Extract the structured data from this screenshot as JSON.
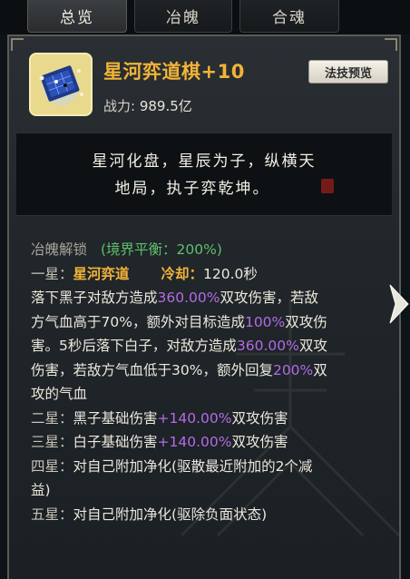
{
  "tabs": [
    {
      "label": "总览",
      "active": true
    },
    {
      "label": "冶魄",
      "active": false
    },
    {
      "label": "合魂",
      "active": false
    }
  ],
  "item": {
    "name": "星河弈道棋+10",
    "power_label": "战力:",
    "power_value": "989.5亿",
    "preview_button": "法技预览",
    "icon": "star-river-chessboard-icon"
  },
  "description": {
    "line1": "星河化盘，星辰为子，纵横天",
    "line2": "地局，执子弈乾坤。"
  },
  "unlock": {
    "title": "冶魄解锁",
    "status": "(境界平衡：200%)"
  },
  "stars": {
    "one": {
      "label": "一星：",
      "skill_name": "星河弈道",
      "cooldown_label": "冷却：",
      "cooldown_value": "120.0秒",
      "line1_a": "落下黑子对敌方造成",
      "line1_pct": "360.00%",
      "line1_b": "双攻伤害，若敌",
      "line2_a": "方气血高于70%，额外对目标造成",
      "line2_pct": "100%",
      "line2_b": "双攻伤",
      "line3_a": "害。5秒后落下白子，对敌方造成",
      "line3_pct": "360.00%",
      "line3_b": "双攻",
      "line4_a": "伤害，若敌方气血低于30%，额外回复",
      "line4_pct": "200%",
      "line4_b": "双",
      "line5": "攻的气血"
    },
    "two": {
      "label": "二星：",
      "text_a": "黑子基础伤害",
      "pct": "+140.00%",
      "text_b": "双攻伤害"
    },
    "three": {
      "label": "三星：",
      "text_a": "白子基础伤害",
      "pct": "+140.00%",
      "text_b": "双攻伤害"
    },
    "four": {
      "label": "四星：",
      "line1": "对自己附加净化(驱散最近附加的2个减",
      "line2": "益)"
    },
    "five": {
      "label": "五星：",
      "line1": "对自己附加净化(驱除负面状态)"
    }
  },
  "colors": {
    "accent_gold": "#f2b337",
    "percent_purple": "#b56ae6",
    "status_green": "#5fbf6a"
  },
  "icons": [
    "star-river-chessboard-icon",
    "seal-icon",
    "next-arrow-icon"
  ]
}
